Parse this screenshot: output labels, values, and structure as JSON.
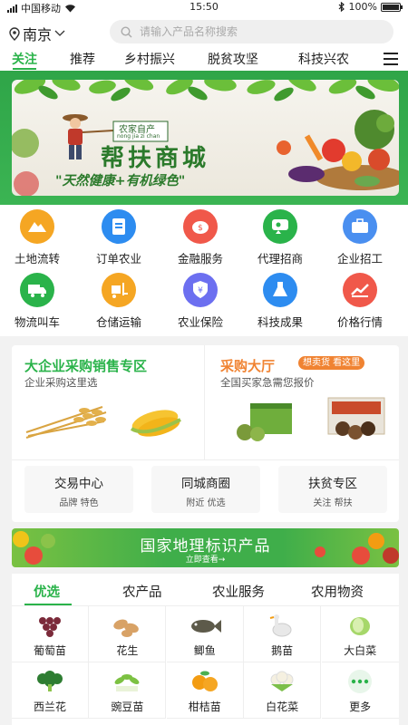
{
  "status_bar": {
    "carrier": "中国移动",
    "time": "15:50",
    "battery": "100%",
    "battery_level": 1.0
  },
  "header": {
    "city": "南京",
    "search_placeholder": "请输入产品名称搜索"
  },
  "tabs": [
    "关注",
    "推荐",
    "乡村振兴",
    "脱贫攻坚",
    "科技兴农"
  ],
  "active_tab": 0,
  "banner": {
    "tag": "农家自产",
    "tag_pinyin": "nong jia zi chan",
    "title": "帮扶商城",
    "slogan": "\"天然健康+有机绿色\""
  },
  "services": [
    {
      "label": "土地流转",
      "icon": "mountain-icon",
      "color": "#f5a623"
    },
    {
      "label": "订单农业",
      "icon": "document-icon",
      "color": "#2d8cf0"
    },
    {
      "label": "金融服务",
      "icon": "piggy-bank-icon",
      "color": "#f0584a"
    },
    {
      "label": "代理招商",
      "icon": "chat-user-icon",
      "color": "#2ab34a"
    },
    {
      "label": "企业招工",
      "icon": "briefcase-icon",
      "color": "#4a8ff0"
    },
    {
      "label": "物流叫车",
      "icon": "truck-icon",
      "color": "#2ab34a"
    },
    {
      "label": "仓储运输",
      "icon": "forklift-icon",
      "color": "#f5a623"
    },
    {
      "label": "农业保险",
      "icon": "shield-yen-icon",
      "color": "#6c6ff0"
    },
    {
      "label": "科技成果",
      "icon": "flask-icon",
      "color": "#2d8cf0"
    },
    {
      "label": "价格行情",
      "icon": "trend-chart-icon",
      "color": "#f0584a"
    }
  ],
  "promo": {
    "left": {
      "title": "大企业采购销售专区",
      "subtitle": "企业采购这里选"
    },
    "right": {
      "title": "采购大厅",
      "badge": "想卖货 看这里",
      "subtitle": "全国买家急需您报价"
    },
    "cards": [
      {
        "title": "交易中心",
        "sub": "品牌  特色"
      },
      {
        "title": "同城商圈",
        "sub": "附近  优选"
      },
      {
        "title": "扶贫专区",
        "sub": "关注  帮扶"
      }
    ]
  },
  "geo_banner": {
    "title": "国家地理标识产品",
    "link": "立即查看→"
  },
  "category_tabs": [
    "优选",
    "农产品",
    "农业服务",
    "农用物资"
  ],
  "active_category": 0,
  "products": [
    {
      "label": "葡萄苗",
      "icon": "grapes-icon"
    },
    {
      "label": "花生",
      "icon": "peanut-icon"
    },
    {
      "label": "鲫鱼",
      "icon": "fish-icon"
    },
    {
      "label": "鹅苗",
      "icon": "goose-icon"
    },
    {
      "label": "大白菜",
      "icon": "cabbage-icon"
    },
    {
      "label": "西兰花",
      "icon": "broccoli-icon"
    },
    {
      "label": "豌豆苗",
      "icon": "pea-sprout-icon"
    },
    {
      "label": "柑桔苗",
      "icon": "orange-icon"
    },
    {
      "label": "白花菜",
      "icon": "cauliflower-icon"
    },
    {
      "label": "更多",
      "icon": "more-icon"
    }
  ],
  "colors": {
    "accent": "#2ab34a",
    "orange": "#f08332"
  }
}
